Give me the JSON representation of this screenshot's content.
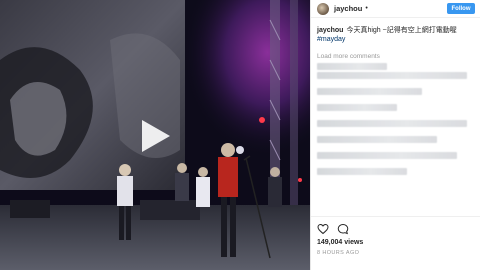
{
  "post": {
    "username": "jaychou",
    "follow_label": "Follow",
    "caption_user": "jaychou",
    "caption_text": "今天真high ~記得有空上網打電動喔",
    "hashtag": "#mayday",
    "load_more_label": "Load more comments",
    "views": "149,004 views",
    "time_ago": "8 HOURS AGO"
  },
  "icons": {
    "like": "heart-icon",
    "comment": "comment-bubble-icon",
    "play": "play-icon"
  },
  "colors": {
    "follow_button": "#3897f0",
    "hashtag": "#003569",
    "muted_text": "#999999"
  }
}
